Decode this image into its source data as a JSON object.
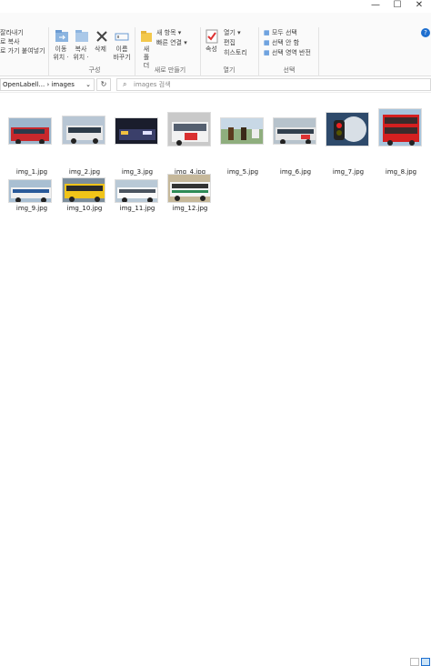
{
  "window": {
    "minimize": "—",
    "maximize": "☐",
    "close": "✕"
  },
  "ribbon": {
    "clipboard": {
      "line1": "잘라내기",
      "line2": "로 복사",
      "line3": "로 가기 붙여넣기"
    },
    "organize": {
      "move_to": "이동\n위치 ·",
      "copy_to": "복사\n위치 ·",
      "delete": "삭제",
      "rename": "이름\n바꾸기",
      "group": "구성"
    },
    "new": {
      "new_folder": "새\n폴더",
      "new_item": "새 항목 ▾",
      "easy_access": "빠른 연결 ▾",
      "group": "새로 만들기"
    },
    "open": {
      "properties": "속성",
      "open": "열기 ▾",
      "edit": "편집",
      "history": "히스토리",
      "group": "열기"
    },
    "select": {
      "select_all": "모두 선택",
      "select_none": "선택 안 함",
      "invert": "선택 영역 반전",
      "group": "선택"
    },
    "help": "?"
  },
  "address": {
    "path_parent": "OpenLabell...",
    "sep": "›",
    "path_current": "images",
    "dropdown": "⌄",
    "refresh": "↻",
    "search_placeholder": "images 검색"
  },
  "files": [
    {
      "name": "img_1.jpg"
    },
    {
      "name": "img_2.jpg"
    },
    {
      "name": "img_3.jpg"
    },
    {
      "name": "img_4.jpg"
    },
    {
      "name": "img_5.jpg"
    },
    {
      "name": "img_6.jpg"
    },
    {
      "name": "img_7.jpg"
    },
    {
      "name": "img_8.jpg"
    },
    {
      "name": "img_9.jpg"
    },
    {
      "name": "img_10.jpg"
    },
    {
      "name": "img_11.jpg"
    },
    {
      "name": "img_12.jpg"
    }
  ],
  "colors": {
    "accent": "#1e6fcf",
    "selection": "#cce4f7"
  }
}
